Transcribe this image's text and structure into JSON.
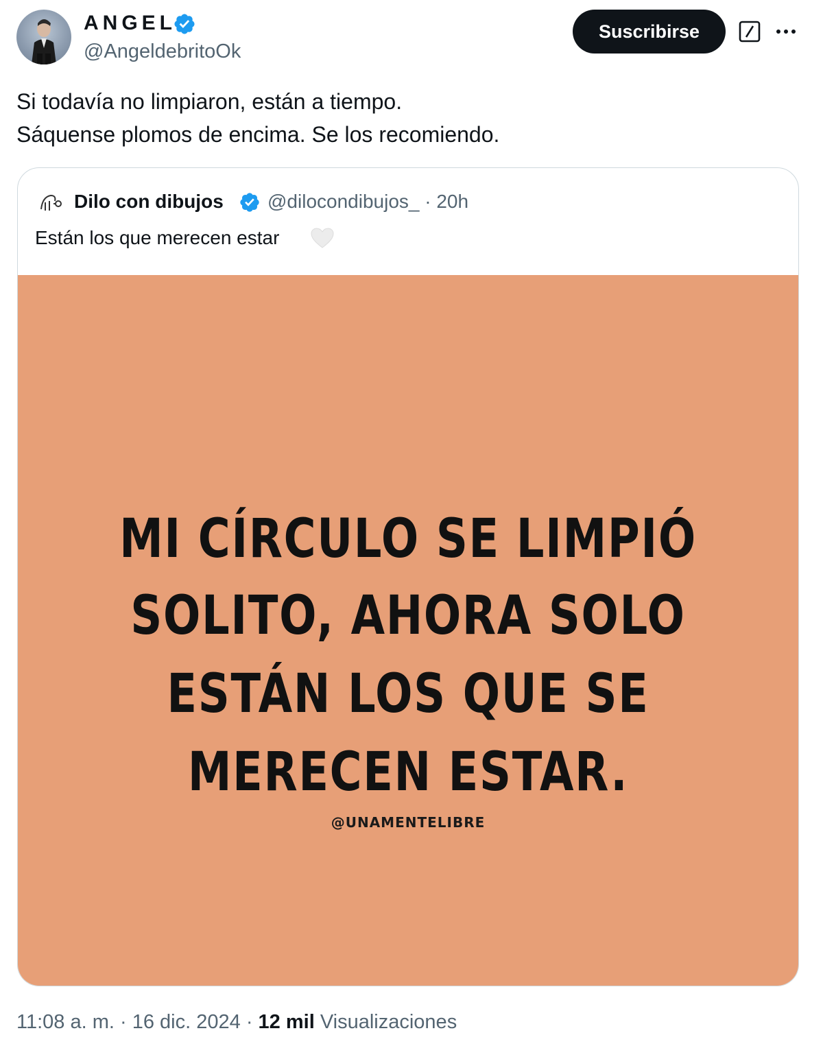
{
  "author": {
    "name": "ANGEL",
    "handle": "@AngeldebritoOk",
    "verified": true
  },
  "actions": {
    "subscribe_label": "Suscribirse",
    "grok_icon": "grok-slash-icon",
    "more_icon": "more-options-icon"
  },
  "tweet": {
    "lines": [
      "Si todavía no limpiaron, están a tiempo.",
      "Sáquense plomos de encima. Se los recomiendo."
    ]
  },
  "quote": {
    "name": "Dilo con dibujos",
    "handle": "@dilocondibujos_",
    "separator": "·",
    "time": "20h",
    "text": "Están los que merecen estar",
    "image": {
      "background": "#e79f77",
      "lines": [
        "MI CÍRCULO SE LIMPIÓ",
        "SOLITO, AHORA SOLO",
        "ESTÁN LOS QUE SE",
        "MERECEN ESTAR."
      ],
      "credit": "@UNAMENTELIBRE"
    }
  },
  "footer": {
    "time": "11:08 a. m.",
    "sep1": "·",
    "date": "16 dic. 2024",
    "sep2": "·",
    "views_count": "12 mil",
    "views_label": "Visualizaciones"
  },
  "colors": {
    "verified": "#1d9bf0",
    "text": "#0f1419",
    "secondary": "#536471",
    "border": "#cfd9de"
  }
}
